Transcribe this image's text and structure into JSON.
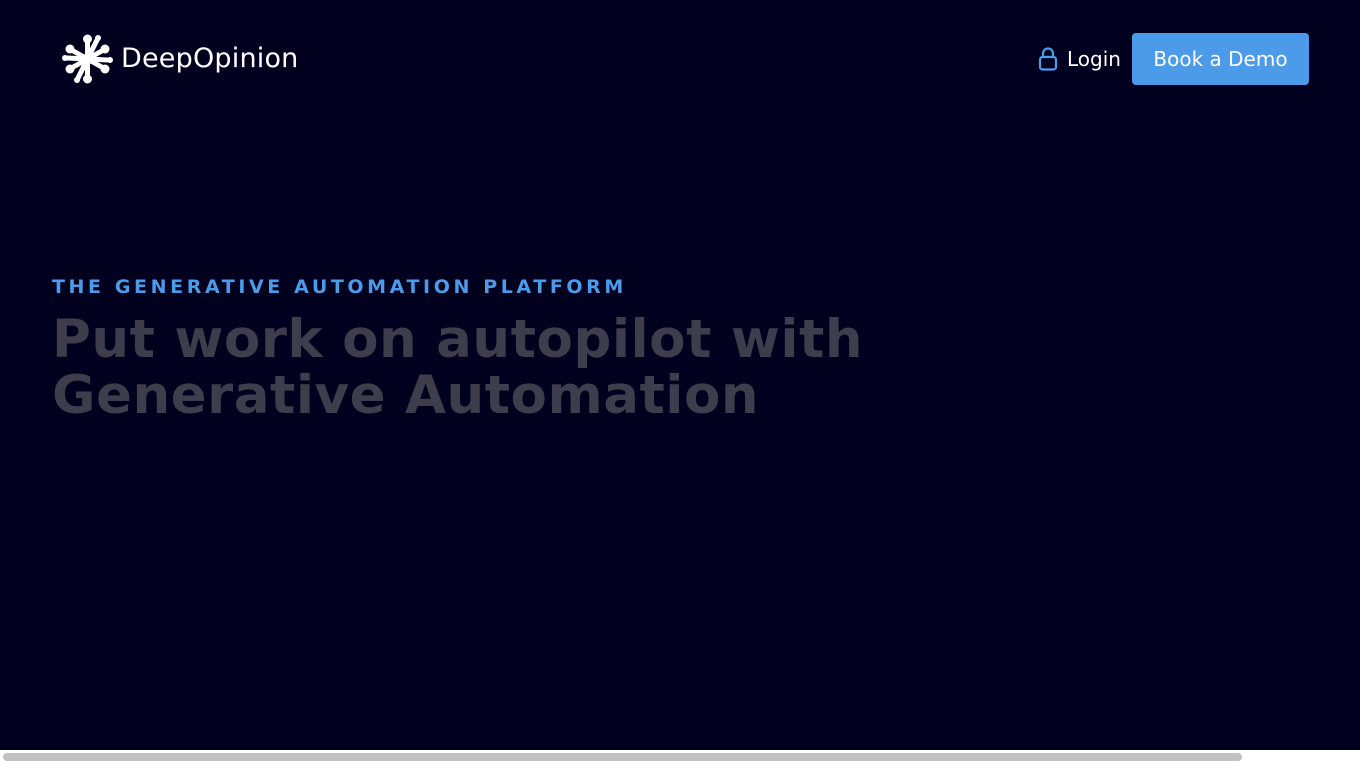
{
  "header": {
    "brand_name": "DeepOpinion",
    "logo_icon": "asterisk-flower-logo-icon",
    "login_label": "Login",
    "login_icon": "lock-icon",
    "cta_label": "Book a Demo"
  },
  "hero": {
    "eyebrow": "THE GENERATIVE AUTOMATION PLATFORM",
    "headline_line1": "Put work on autopilot with",
    "headline_line2": "Generative Automation"
  },
  "colors": {
    "background": "#01001f",
    "accent": "#4b9be8",
    "headline": "#3d3d4c",
    "text": "#ffffff"
  }
}
